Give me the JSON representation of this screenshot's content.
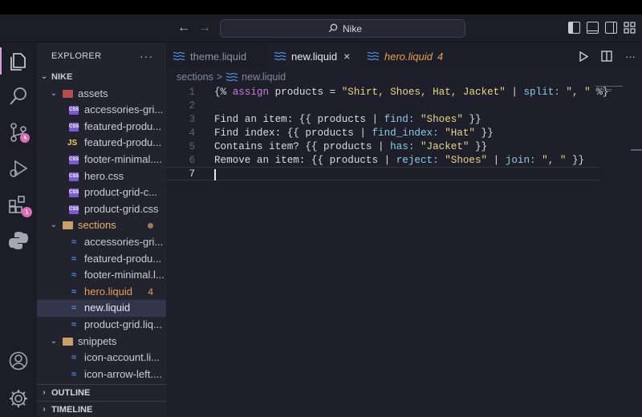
{
  "titlebar": {
    "command_center": "Nike"
  },
  "explorer": {
    "title": "EXPLORER",
    "more": "···",
    "root": "NIKE",
    "folders": {
      "assets": {
        "label": "assets",
        "files": [
          "accessories-gri...",
          "featured-produ...",
          "featured-produ...",
          "footer-minimal....",
          "hero.css",
          "product-grid-c...",
          "product-grid.css"
        ]
      },
      "sections": {
        "label": "sections",
        "files": [
          "accessories-gri...",
          "featured-produ...",
          "footer-minimal.l...",
          "hero.liquid",
          "new.liquid",
          "product-grid.liq..."
        ],
        "hero_count": "4"
      },
      "snippets": {
        "label": "snippets",
        "files": [
          "icon-account.li...",
          "icon-arrow-left...."
        ]
      }
    },
    "outline": "OUTLINE",
    "timeline": "TIMELINE"
  },
  "activity": {
    "extensions_badge": "1"
  },
  "tabs": [
    {
      "label": "theme.liquid"
    },
    {
      "label": "new.liquid",
      "close": "×"
    },
    {
      "label": "hero.liquid",
      "count": "4"
    }
  ],
  "breadcrumb": {
    "folder": "sections",
    "sep": ">",
    "file": "new.liquid"
  },
  "editor": {
    "line_numbers": [
      "1",
      "2",
      "3",
      "4",
      "5",
      "6",
      "7"
    ],
    "lines": [
      [
        "{% ",
        "assign",
        " products = ",
        "\"Shirt, Shoes, Hat, Jacket\"",
        " | ",
        "split:",
        " ",
        "\", \"",
        " %}"
      ],
      [],
      [
        "Find an item: {{ products | ",
        "find:",
        " ",
        "\"Shoes\"",
        " }}"
      ],
      [
        "Find index: {{ products | ",
        "find_index:",
        " ",
        "\"Hat\"",
        " }}"
      ],
      [
        "Contains item? {{ products | ",
        "has:",
        " ",
        "\"Jacket\"",
        " }}"
      ],
      [
        "Remove an item: {{ products | ",
        "reject:",
        " ",
        "\"Shoes\"",
        " | ",
        "join:",
        " ",
        "\", \"",
        " }}"
      ],
      []
    ]
  },
  "colors": {
    "accent": "#d86fb4",
    "modified": "#e59f55",
    "keyword": "#c77dde",
    "string": "#e7d58a",
    "filter": "#8ccbe6"
  }
}
